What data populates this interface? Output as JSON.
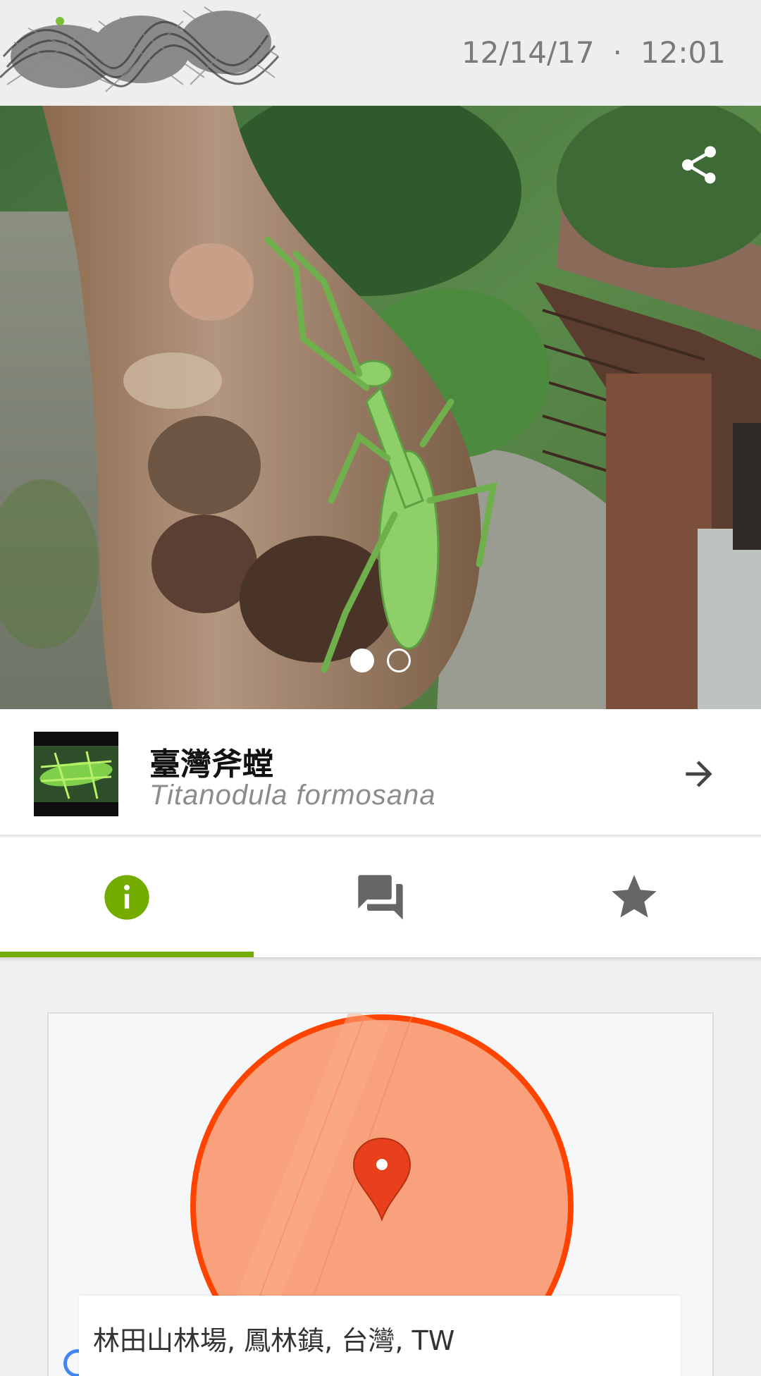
{
  "header": {
    "date": "12/14/17",
    "separator": "·",
    "time": "12:01"
  },
  "photo": {
    "share_icon": "share-icon",
    "page_count": 2,
    "current_page": 1
  },
  "taxon": {
    "common_name": "臺灣斧螳",
    "scientific_name": "Titanodula formosana",
    "arrow_icon": "arrow-right-icon"
  },
  "tabs": [
    {
      "icon": "info-icon",
      "active": true
    },
    {
      "icon": "comments-icon",
      "active": false
    },
    {
      "icon": "star-icon",
      "active": false
    }
  ],
  "map": {
    "pin_icon": "map-pin-icon",
    "location": "林田山林場, 鳳林鎮, 台灣, TW"
  },
  "colors": {
    "accent": "#74ac00",
    "accuracy_fill": "#f9a07c",
    "accuracy_stroke": "#ff4400",
    "pin": "#e8401c"
  }
}
